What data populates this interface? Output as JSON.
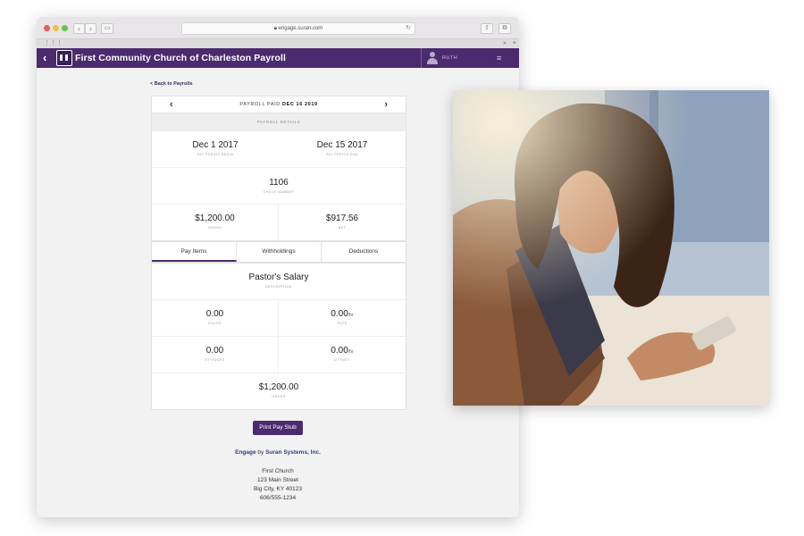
{
  "browser": {
    "url": "engage.suran.com",
    "nav_back": "‹",
    "nav_fwd": "›",
    "bookmark_grid": "⋮⋮⋮",
    "bookmark_more": "»",
    "bookmark_plus": "+"
  },
  "app": {
    "back_glyph": "‹",
    "title": "First Community Church of Charleston Payroll",
    "user_name": "RUTH",
    "menu_glyph": "≡",
    "accent_color": "#4b2a6e"
  },
  "page": {
    "back_link": "< Back to Payrolls",
    "pager": {
      "prev": "‹",
      "next": "›",
      "label": "PAYROLL PAID",
      "date": "DEC 16 2019"
    },
    "details_header": "PAYROLL DETAILS",
    "period_begin": {
      "value": "Dec 1 2017",
      "label": "PAY PERIOD BEGIN"
    },
    "period_end": {
      "value": "Dec 15 2017",
      "label": "PAY PERIOD END"
    },
    "check_number": {
      "value": "1106",
      "label": "CHECK NUMBER"
    },
    "gross": {
      "value": "$1,200.00",
      "label": "GROSS"
    },
    "net": {
      "value": "$917.56",
      "label": "NET"
    },
    "tabs": [
      {
        "label": "Pay Items",
        "active": true
      },
      {
        "label": "Withholdings",
        "active": false
      },
      {
        "label": "Deductions",
        "active": false
      }
    ],
    "item": {
      "description": {
        "value": "Pastor's Salary",
        "label": "DESCRIPTION"
      },
      "hours": {
        "value": "0.00",
        "label": "HOURS"
      },
      "rate": {
        "value": "0.00",
        "unit": "/hr",
        "label": "RATE"
      },
      "ot_hours": {
        "value": "0.00",
        "label": "OT HOURS"
      },
      "ot_rate": {
        "value": "0.00",
        "unit": "/hr",
        "label": "OT RATE"
      },
      "gross": {
        "value": "$1,200.00",
        "label": "GROSS"
      }
    },
    "print_button": "Print Pay Stub",
    "footer": {
      "brand": "Engage",
      "by": " by ",
      "company": "Suran Systems, Inc.",
      "address": [
        "First Church",
        "123 Main Street",
        "Big City, KY 40123",
        "606/555-1234"
      ]
    }
  }
}
